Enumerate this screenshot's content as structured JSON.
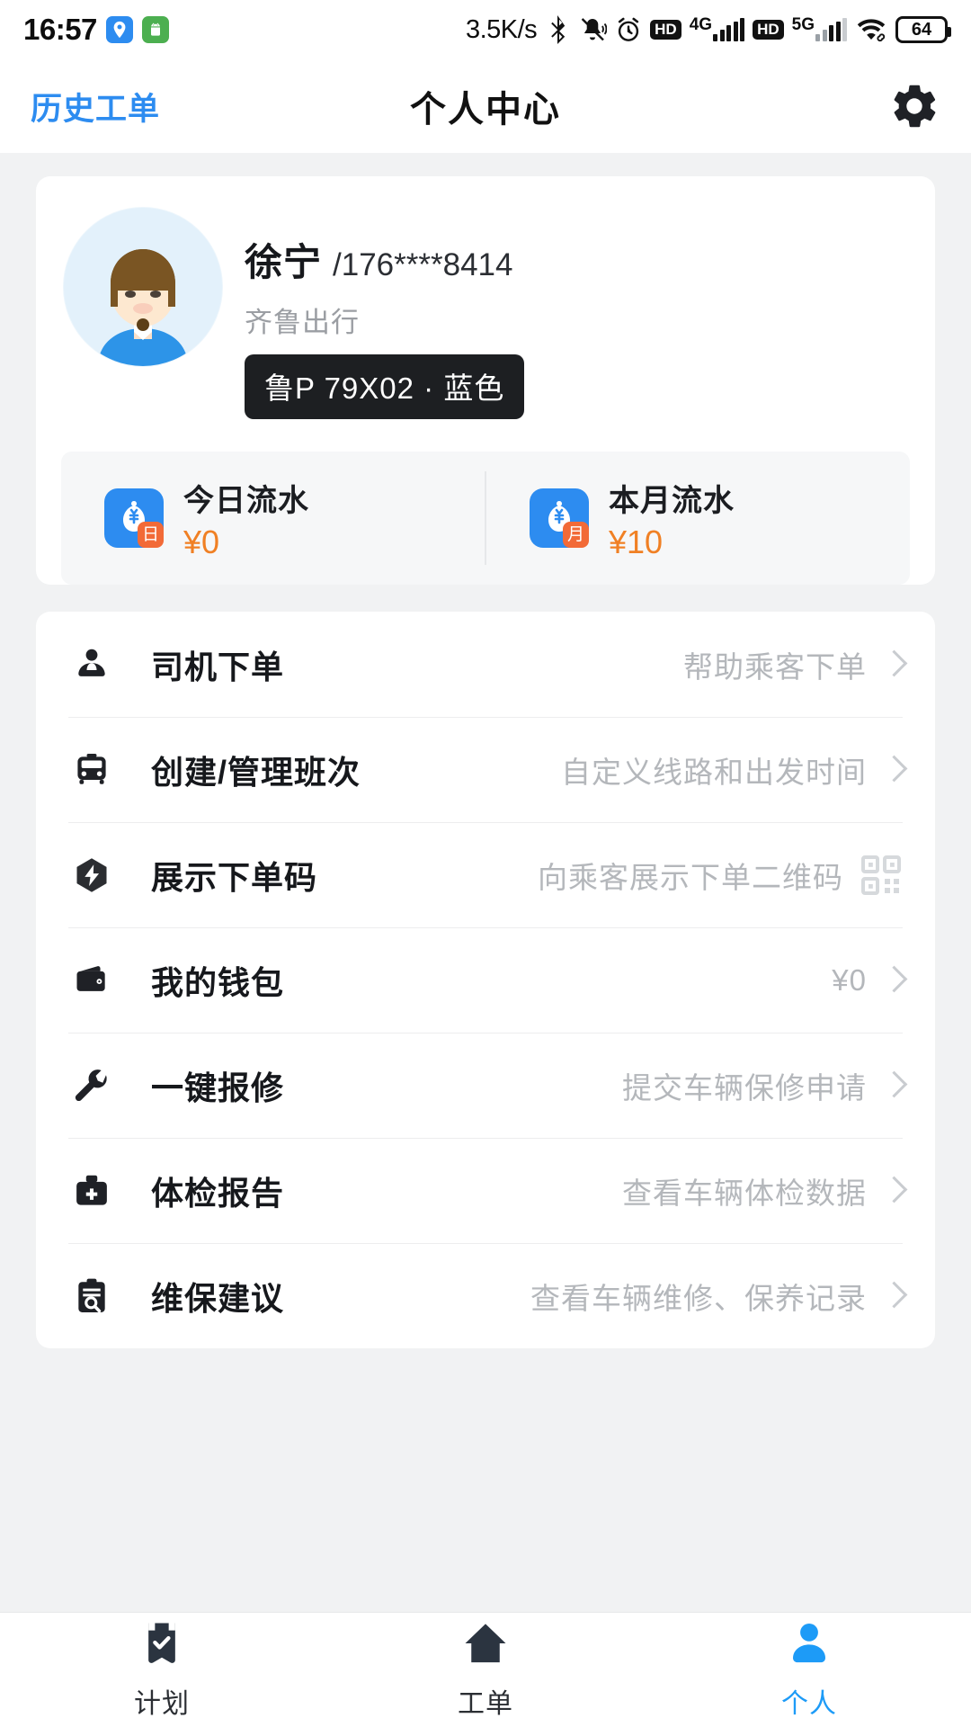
{
  "statusbar": {
    "time": "16:57",
    "network_speed": "3.5K/s",
    "hd_label_1": "HD",
    "gen_label_1": "4G",
    "hd_label_2": "HD",
    "gen_label_2": "5G",
    "battery": "64",
    "icons": [
      "location-icon",
      "android-app-icon",
      "bluetooth-icon",
      "mute-vibrate-icon",
      "alarm-icon",
      "wifi-icon"
    ]
  },
  "header": {
    "back_link": "历史工单",
    "title": "个人中心",
    "settings_icon": "gear-icon"
  },
  "profile": {
    "name": "徐宁",
    "phone": "/176****8414",
    "company": "齐鲁出行",
    "plate": "鲁P 79X02 · 蓝色"
  },
  "revenue": [
    {
      "label": "今日流水",
      "value": "¥0",
      "badge": "日",
      "icon": "money-bag-icon"
    },
    {
      "label": "本月流水",
      "value": "¥10",
      "badge": "月",
      "icon": "money-bag-icon"
    }
  ],
  "menu": [
    {
      "label": "司机下单",
      "sub": "帮助乘客下单",
      "icon": "driver-person-icon",
      "chevron": true,
      "qr": false,
      "value": ""
    },
    {
      "label": "创建/管理班次",
      "sub": "自定义线路和出发时间",
      "icon": "bus-icon",
      "chevron": true,
      "qr": false,
      "value": ""
    },
    {
      "label": "展示下单码",
      "sub": "向乘客展示下单二维码",
      "icon": "lightning-hex-icon",
      "chevron": false,
      "qr": true,
      "value": ""
    },
    {
      "label": "我的钱包",
      "sub": "¥0",
      "icon": "wallet-icon",
      "chevron": true,
      "qr": false,
      "value": "¥0"
    },
    {
      "label": "一键报修",
      "sub": "提交车辆保修申请",
      "icon": "wrench-icon",
      "chevron": true,
      "qr": false,
      "value": ""
    },
    {
      "label": "体检报告",
      "sub": "查看车辆体检数据",
      "icon": "medical-kit-icon",
      "chevron": true,
      "qr": false,
      "value": ""
    },
    {
      "label": "维保建议",
      "sub": "查看车辆维修、保养记录",
      "icon": "clipboard-search-icon",
      "chevron": true,
      "qr": false,
      "value": ""
    }
  ],
  "tabbar": [
    {
      "label": "计划",
      "icon": "checklist-icon",
      "active": false
    },
    {
      "label": "工单",
      "icon": "home-icon",
      "active": false
    },
    {
      "label": "个人",
      "icon": "person-icon",
      "active": true
    }
  ],
  "colors": {
    "accent": "#1d9bf7",
    "link": "#2d8cf0",
    "amount": "#f08024",
    "page_bg": "#f1f2f3",
    "card_bg": "#ffffff",
    "plate_bg": "#1d1f22"
  }
}
